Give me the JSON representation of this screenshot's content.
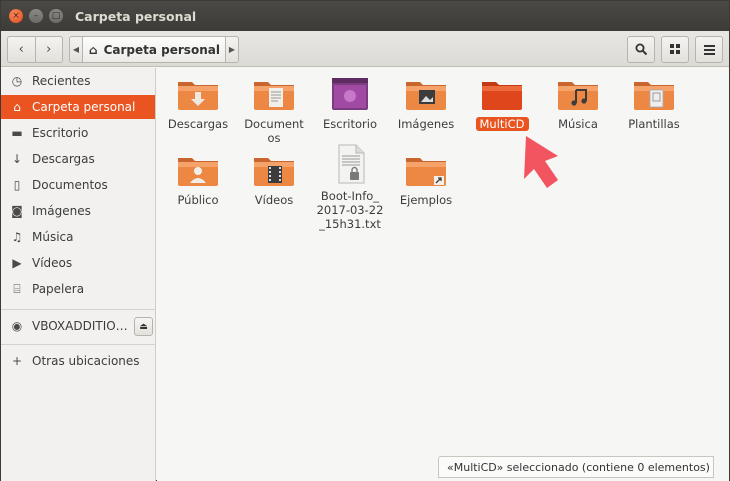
{
  "window": {
    "title": "Carpeta personal",
    "controls": {
      "close": "×",
      "minimize": "–",
      "maximize": "□"
    }
  },
  "header": {
    "back": "‹",
    "forward": "›",
    "path_prev": "◀",
    "path_next": "▶",
    "path_home_icon": "home-icon",
    "path_label": "Carpeta personal",
    "search_icon": "search-icon",
    "view_icon": "grid-icon",
    "menu_icon": "menu-icon"
  },
  "sidebar": {
    "items": [
      {
        "label": "Recientes",
        "icon": "clock-icon",
        "glyph": "◷",
        "active": false
      },
      {
        "label": "Carpeta personal",
        "icon": "home-icon",
        "glyph": "⌂",
        "active": true
      },
      {
        "label": "Escritorio",
        "icon": "desktop-icon",
        "glyph": "▬",
        "active": false
      },
      {
        "label": "Descargas",
        "icon": "download-icon",
        "glyph": "↓",
        "active": false
      },
      {
        "label": "Documentos",
        "icon": "document-icon",
        "glyph": "▯",
        "active": false
      },
      {
        "label": "Imágenes",
        "icon": "camera-icon",
        "glyph": "◙",
        "active": false
      },
      {
        "label": "Música",
        "icon": "music-icon",
        "glyph": "♫",
        "active": false
      },
      {
        "label": "Vídeos",
        "icon": "video-icon",
        "glyph": "▶",
        "active": false
      },
      {
        "label": "Papelera",
        "icon": "trash-icon",
        "glyph": "⌸",
        "active": false
      }
    ],
    "device": {
      "label": "VBOXADDITIO…",
      "icon": "disc-icon",
      "glyph": "◉",
      "eject": "⏏"
    },
    "other": {
      "label": "Otras ubicaciones",
      "icon": "plus-icon",
      "glyph": "+"
    }
  },
  "files": [
    {
      "label": "Descargas",
      "type": "folder-download"
    },
    {
      "label": "Documentos",
      "type": "folder-document"
    },
    {
      "label": "Escritorio",
      "type": "folder-desktop"
    },
    {
      "label": "Imágenes",
      "type": "folder-pictures"
    },
    {
      "label": "MultiCD",
      "type": "folder-plain",
      "selected": true
    },
    {
      "label": "Música",
      "type": "folder-music"
    },
    {
      "label": "Plantillas",
      "type": "folder-templates"
    },
    {
      "label": "Público",
      "type": "folder-public"
    },
    {
      "label": "Vídeos",
      "type": "folder-videos"
    },
    {
      "label": "Boot-Info_\n2017-03-22\n_15h31.txt",
      "type": "text-file"
    },
    {
      "label": "Ejemplos",
      "type": "folder-link"
    }
  ],
  "status": {
    "text": "«MultiCD» seleccionado  (contiene 0 elementos)",
    "close": "×"
  },
  "colors": {
    "accent": "#e95420",
    "folder_top": "#f2a26c",
    "folder_body": "#e9803f",
    "arrow": "#f2555f"
  }
}
